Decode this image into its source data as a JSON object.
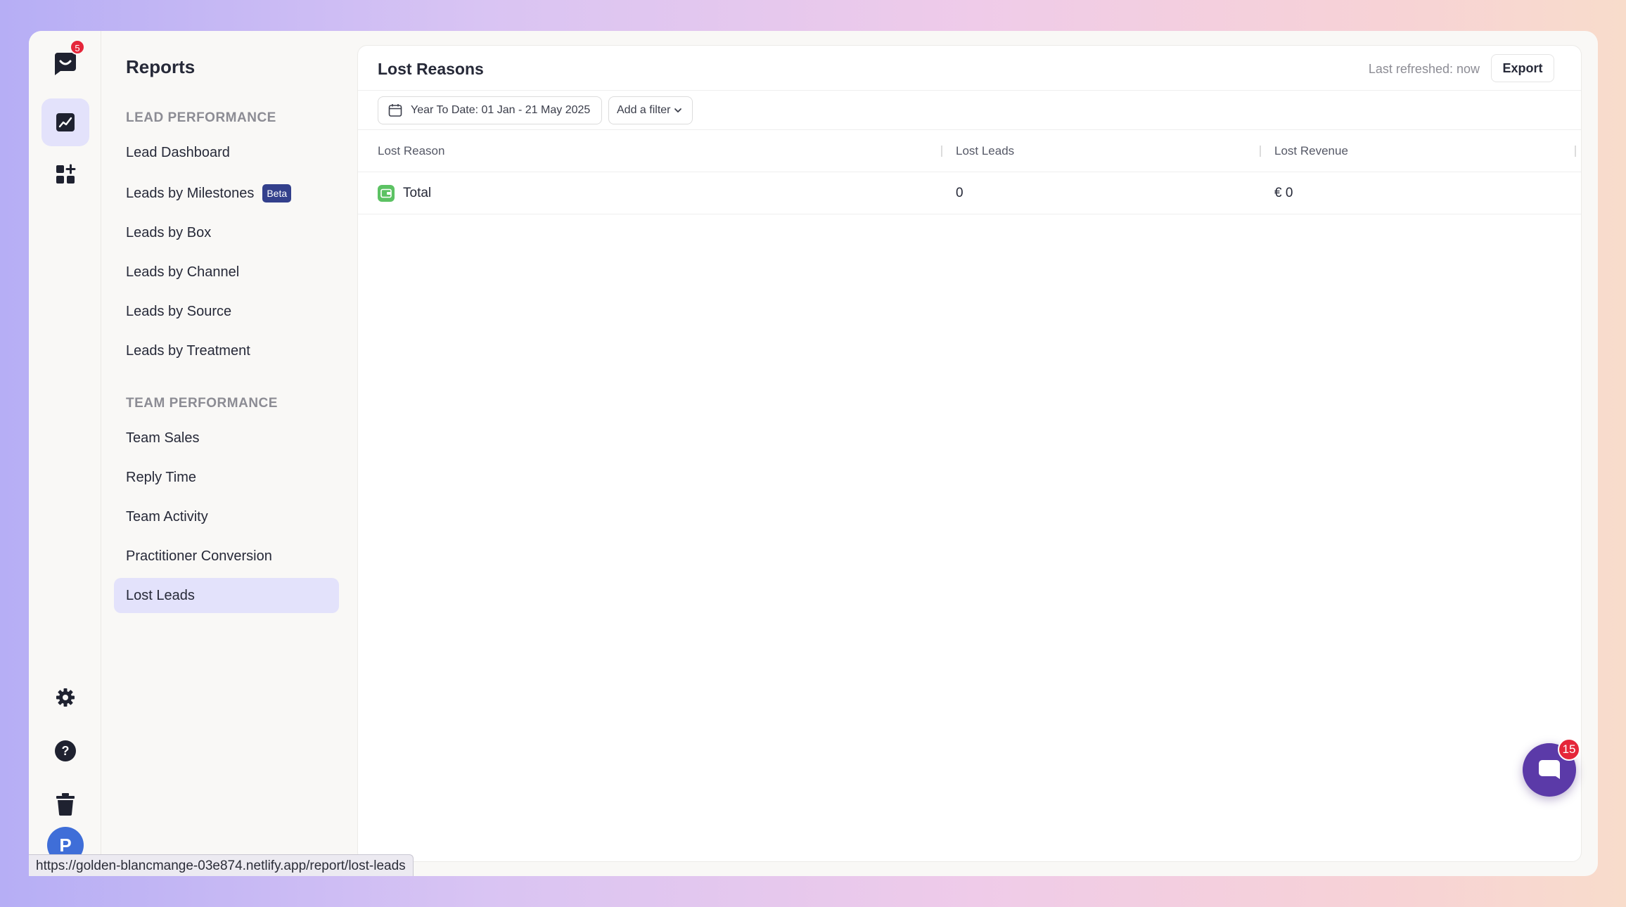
{
  "app": {
    "logo_badge": "5",
    "avatar_initial": "P"
  },
  "sidebar": {
    "title": "Reports",
    "sections": [
      {
        "title": "LEAD PERFORMANCE",
        "items": [
          {
            "label": "Lead Dashboard"
          },
          {
            "label": "Leads by Milestones",
            "badge": "Beta"
          },
          {
            "label": "Leads by Box"
          },
          {
            "label": "Leads by Channel"
          },
          {
            "label": "Leads by Source"
          },
          {
            "label": "Leads by Treatment"
          }
        ]
      },
      {
        "title": "TEAM PERFORMANCE",
        "items": [
          {
            "label": "Team Sales"
          },
          {
            "label": "Reply Time"
          },
          {
            "label": "Team Activity"
          },
          {
            "label": "Practitioner Conversion"
          },
          {
            "label": "Lost Leads",
            "active": true
          }
        ]
      }
    ]
  },
  "main": {
    "title": "Lost Reasons",
    "last_refreshed": "Last refreshed: now",
    "export_label": "Export",
    "date_filter": "Year To Date: 01 Jan - 21 May 2025",
    "add_filter_label": "Add a filter",
    "table": {
      "columns": [
        "Lost Reason",
        "Lost Leads",
        "Lost Revenue"
      ],
      "rows": [
        {
          "reason": "Total",
          "lost_leads": "0",
          "lost_revenue": "€ 0"
        }
      ]
    }
  },
  "chat": {
    "badge": "15"
  },
  "status_url": "https://golden-blancmange-03e874.netlify.app/report/lost-leads",
  "colors": {
    "accent": "#e3e2fb",
    "beta_badge": "#33408c",
    "notification": "#e5263a",
    "chat": "#5b3aa8",
    "total_icon": "#5cc263"
  }
}
